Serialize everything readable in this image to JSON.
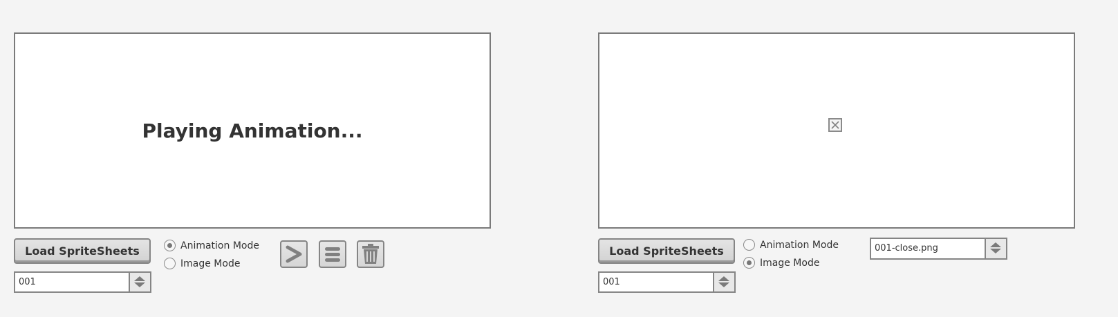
{
  "left_panel": {
    "canvas_text": "Playing Animation...",
    "load_button_label": "Load SpriteSheets",
    "mode_options": [
      {
        "label": "Animation Mode",
        "selected": true
      },
      {
        "label": "Image Mode",
        "selected": false
      }
    ],
    "frame_spinner_value": "001",
    "toolbar": [
      {
        "icon": "play-chevron-icon"
      },
      {
        "icon": "menu-icon"
      },
      {
        "icon": "trash-icon"
      }
    ]
  },
  "right_panel": {
    "canvas_image_icon": "broken-image-icon",
    "load_button_label": "Load SpriteSheets",
    "mode_options": [
      {
        "label": "Animation Mode",
        "selected": false
      },
      {
        "label": "Image Mode",
        "selected": true
      }
    ],
    "frame_spinner_value": "001",
    "file_spinner_value": "001-close.png"
  },
  "colors": {
    "page_background": "#f4f4f4",
    "canvas_background": "#ffffff",
    "border": "#7a7a7a",
    "button_face": "#dcdcdc"
  }
}
